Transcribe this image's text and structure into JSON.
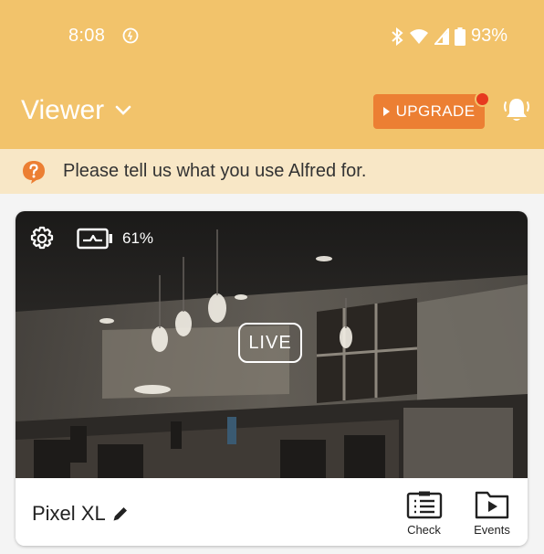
{
  "status_bar": {
    "time": "8:08",
    "battery": "93%",
    "icons": [
      "dnd-icon",
      "bluetooth-icon",
      "wifi-icon",
      "signal-icon",
      "battery-icon"
    ]
  },
  "app_bar": {
    "title": "Viewer",
    "upgrade_label": "UPGRADE",
    "bg_color": "#f2c36b",
    "accent_color": "#ec7f33"
  },
  "banner": {
    "text": "Please tell us what you use Alfred for."
  },
  "camera_card": {
    "battery_level": "61%",
    "live_label": "LIVE",
    "device_name": "Pixel XL",
    "actions": [
      {
        "label": "Check",
        "icon": "checklist-icon"
      },
      {
        "label": "Events",
        "icon": "events-folder-icon"
      }
    ]
  }
}
